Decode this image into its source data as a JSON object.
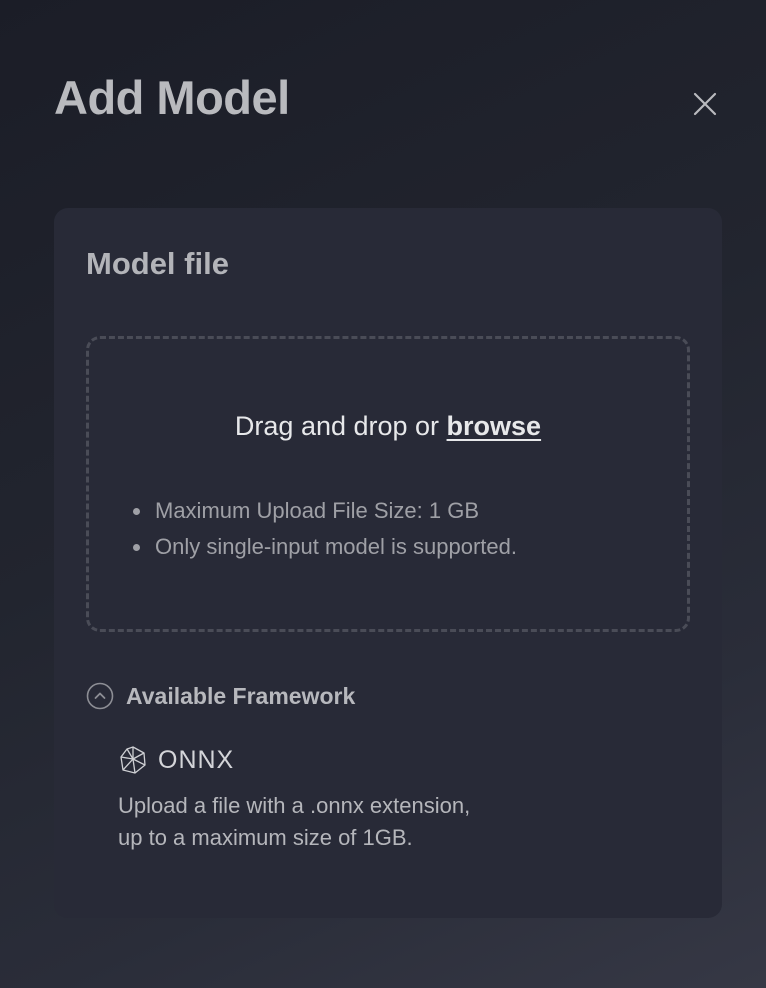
{
  "modal": {
    "title": "Add Model",
    "close_icon": "close-icon"
  },
  "card": {
    "title": "Model file",
    "dropzone": {
      "text": "Drag and drop or ",
      "browse_label": "browse",
      "rules": [
        "Maximum Upload File Size: 1 GB",
        "Only single-input model is supported."
      ]
    },
    "framework": {
      "toggle_label": "Available Framework",
      "toggle_icon": "chevron-up-circle-icon",
      "expanded": true,
      "items": [
        {
          "name": "ONNX",
          "icon": "onnx-logo-icon",
          "description_line1": "Upload a file with a .onnx extension,",
          "description_line2": "up to a maximum size of 1GB."
        }
      ]
    }
  },
  "colors": {
    "background_start": "#1b1d27",
    "background_end": "#363845",
    "card": "#282a37",
    "dropzone_border": "#4a4c57",
    "text_primary": "#e7e8ea",
    "text_muted": "#9fa0a6"
  }
}
